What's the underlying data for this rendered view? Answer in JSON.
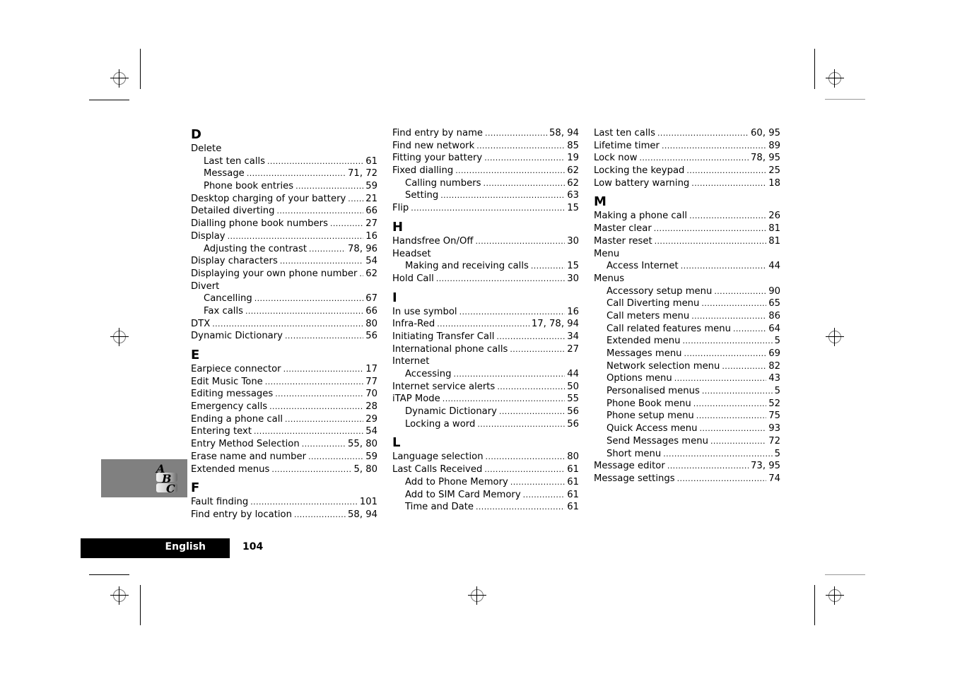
{
  "footer": {
    "language": "English",
    "page_number": "104"
  },
  "tab_icon": {
    "name": "abc-index-icon",
    "letters": [
      "A",
      "B",
      "C"
    ]
  },
  "columns": [
    [
      {
        "type": "letter",
        "text": "D"
      },
      {
        "type": "entry",
        "level": 0,
        "text": "Delete",
        "pages": ""
      },
      {
        "type": "entry",
        "level": 1,
        "text": "Last ten calls",
        "pages": "61"
      },
      {
        "type": "entry",
        "level": 1,
        "text": "Message",
        "pages": "71, 72"
      },
      {
        "type": "entry",
        "level": 1,
        "text": "Phone book entries",
        "pages": "59"
      },
      {
        "type": "entry",
        "level": 0,
        "text": "Desktop charging of your battery",
        "pages": "21"
      },
      {
        "type": "entry",
        "level": 0,
        "text": "Detailed diverting",
        "pages": "66"
      },
      {
        "type": "entry",
        "level": 0,
        "text": "Dialling phone book numbers",
        "pages": "27"
      },
      {
        "type": "entry",
        "level": 0,
        "text": "Display",
        "pages": "16"
      },
      {
        "type": "entry",
        "level": 1,
        "text": "Adjusting the contrast",
        "pages": "78, 96"
      },
      {
        "type": "entry",
        "level": 0,
        "text": "Display characters",
        "pages": "54"
      },
      {
        "type": "entry",
        "level": 0,
        "text": "Displaying your own phone number",
        "pages": "62"
      },
      {
        "type": "entry",
        "level": 0,
        "text": "Divert",
        "pages": ""
      },
      {
        "type": "entry",
        "level": 1,
        "text": "Cancelling",
        "pages": "67"
      },
      {
        "type": "entry",
        "level": 1,
        "text": "Fax calls",
        "pages": "66"
      },
      {
        "type": "entry",
        "level": 0,
        "text": "DTX",
        "pages": "80"
      },
      {
        "type": "entry",
        "level": 0,
        "text": "Dynamic Dictionary",
        "pages": "56"
      },
      {
        "type": "letter",
        "text": "E"
      },
      {
        "type": "entry",
        "level": 0,
        "text": "Earpiece connector",
        "pages": "17"
      },
      {
        "type": "entry",
        "level": 0,
        "text": "Edit Music Tone",
        "pages": "77"
      },
      {
        "type": "entry",
        "level": 0,
        "text": "Editing messages",
        "pages": "70"
      },
      {
        "type": "entry",
        "level": 0,
        "text": "Emergency calls",
        "pages": "28"
      },
      {
        "type": "entry",
        "level": 0,
        "text": "Ending a phone call",
        "pages": "29"
      },
      {
        "type": "entry",
        "level": 0,
        "text": "Entering text",
        "pages": "54"
      },
      {
        "type": "entry",
        "level": 0,
        "text": "Entry Method Selection",
        "pages": "55, 80"
      },
      {
        "type": "entry",
        "level": 0,
        "text": "Erase name and number",
        "pages": "59"
      },
      {
        "type": "entry",
        "level": 0,
        "text": "Extended menus",
        "pages": "5, 80"
      },
      {
        "type": "letter",
        "text": "F"
      },
      {
        "type": "entry",
        "level": 0,
        "text": "Fault finding",
        "pages": "101"
      },
      {
        "type": "entry",
        "level": 0,
        "text": "Find entry by location",
        "pages": "58, 94"
      }
    ],
    [
      {
        "type": "entry",
        "level": 0,
        "text": "Find entry by name",
        "pages": "58, 94"
      },
      {
        "type": "entry",
        "level": 0,
        "text": "Find new network",
        "pages": "85"
      },
      {
        "type": "entry",
        "level": 0,
        "text": "Fitting your battery",
        "pages": "19"
      },
      {
        "type": "entry",
        "level": 0,
        "text": "Fixed dialling",
        "pages": "62"
      },
      {
        "type": "entry",
        "level": 1,
        "text": "Calling numbers",
        "pages": "62"
      },
      {
        "type": "entry",
        "level": 1,
        "text": "Setting",
        "pages": "63"
      },
      {
        "type": "entry",
        "level": 0,
        "text": "Flip",
        "pages": "15"
      },
      {
        "type": "letter",
        "text": "H"
      },
      {
        "type": "entry",
        "level": 0,
        "text": "Handsfree On/Off",
        "pages": "30"
      },
      {
        "type": "entry",
        "level": 0,
        "text": "Headset",
        "pages": ""
      },
      {
        "type": "entry",
        "level": 1,
        "text": "Making and receiving calls",
        "pages": "15"
      },
      {
        "type": "entry",
        "level": 0,
        "text": "Hold Call",
        "pages": "30"
      },
      {
        "type": "letter",
        "text": "I"
      },
      {
        "type": "entry",
        "level": 0,
        "text": "In use symbol",
        "pages": "16"
      },
      {
        "type": "entry",
        "level": 0,
        "text": "Infra-Red",
        "pages": "17, 78, 94"
      },
      {
        "type": "entry",
        "level": 0,
        "text": "Initiating Transfer Call",
        "pages": "34"
      },
      {
        "type": "entry",
        "level": 0,
        "text": "International phone calls",
        "pages": "27"
      },
      {
        "type": "entry",
        "level": 0,
        "text": "Internet",
        "pages": ""
      },
      {
        "type": "entry",
        "level": 1,
        "text": "Accessing",
        "pages": "44"
      },
      {
        "type": "entry",
        "level": 0,
        "text": "Internet service alerts",
        "pages": "50"
      },
      {
        "type": "entry",
        "level": 0,
        "text": "iTAP Mode",
        "pages": "55"
      },
      {
        "type": "entry",
        "level": 1,
        "text": "Dynamic Dictionary",
        "pages": "56"
      },
      {
        "type": "entry",
        "level": 1,
        "text": "Locking a word",
        "pages": "56"
      },
      {
        "type": "letter",
        "text": "L"
      },
      {
        "type": "entry",
        "level": 0,
        "text": "Language selection",
        "pages": "80"
      },
      {
        "type": "entry",
        "level": 0,
        "text": "Last Calls Received",
        "pages": "61"
      },
      {
        "type": "entry",
        "level": 1,
        "text": "Add to Phone Memory",
        "pages": "61"
      },
      {
        "type": "entry",
        "level": 1,
        "text": "Add to SIM Card Memory",
        "pages": "61"
      },
      {
        "type": "entry",
        "level": 1,
        "text": "Time and Date",
        "pages": "61"
      }
    ],
    [
      {
        "type": "entry",
        "level": 0,
        "text": "Last ten calls",
        "pages": "60, 95"
      },
      {
        "type": "entry",
        "level": 0,
        "text": "Lifetime timer",
        "pages": "89"
      },
      {
        "type": "entry",
        "level": 0,
        "text": "Lock now",
        "pages": "78, 95"
      },
      {
        "type": "entry",
        "level": 0,
        "text": "Locking the keypad",
        "pages": "25"
      },
      {
        "type": "entry",
        "level": 0,
        "text": "Low battery warning",
        "pages": "18"
      },
      {
        "type": "letter",
        "text": "M"
      },
      {
        "type": "entry",
        "level": 0,
        "text": "Making a phone call",
        "pages": "26"
      },
      {
        "type": "entry",
        "level": 0,
        "text": "Master clear",
        "pages": "81"
      },
      {
        "type": "entry",
        "level": 0,
        "text": "Master reset",
        "pages": "81"
      },
      {
        "type": "entry",
        "level": 0,
        "text": "Menu",
        "pages": ""
      },
      {
        "type": "entry",
        "level": 1,
        "text": "Access Internet",
        "pages": "44"
      },
      {
        "type": "entry",
        "level": 0,
        "text": "Menus",
        "pages": ""
      },
      {
        "type": "entry",
        "level": 1,
        "text": "Accessory setup menu",
        "pages": "90"
      },
      {
        "type": "entry",
        "level": 1,
        "text": "Call Diverting menu",
        "pages": "65"
      },
      {
        "type": "entry",
        "level": 1,
        "text": "Call meters menu",
        "pages": "86"
      },
      {
        "type": "entry",
        "level": 1,
        "text": "Call related features menu",
        "pages": "64"
      },
      {
        "type": "entry",
        "level": 1,
        "text": "Extended menu",
        "pages": "5"
      },
      {
        "type": "entry",
        "level": 1,
        "text": "Messages menu",
        "pages": "69"
      },
      {
        "type": "entry",
        "level": 1,
        "text": "Network selection menu",
        "pages": "82"
      },
      {
        "type": "entry",
        "level": 1,
        "text": "Options menu",
        "pages": "43"
      },
      {
        "type": "entry",
        "level": 1,
        "text": "Personalised menus",
        "pages": "5"
      },
      {
        "type": "entry",
        "level": 1,
        "text": "Phone Book menu",
        "pages": "52"
      },
      {
        "type": "entry",
        "level": 1,
        "text": "Phone setup menu",
        "pages": "75"
      },
      {
        "type": "entry",
        "level": 1,
        "text": "Quick Access menu",
        "pages": "93"
      },
      {
        "type": "entry",
        "level": 1,
        "text": "Send Messages menu",
        "pages": "72"
      },
      {
        "type": "entry",
        "level": 1,
        "text": "Short menu",
        "pages": "5"
      },
      {
        "type": "entry",
        "level": 0,
        "text": "Message editor",
        "pages": "73, 95"
      },
      {
        "type": "entry",
        "level": 0,
        "text": "Message settings",
        "pages": "74"
      }
    ]
  ]
}
